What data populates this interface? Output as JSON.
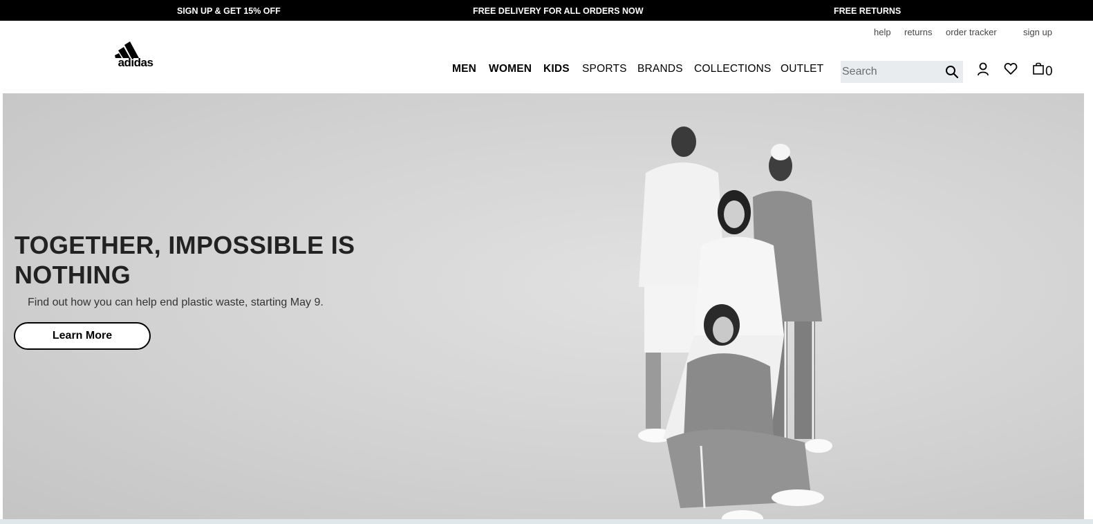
{
  "promo": {
    "left": "SIGN UP & GET 15% OFF",
    "center": "FREE DELIVERY FOR ALL ORDERS NOW",
    "right": "FREE RETURNS"
  },
  "utility_links": {
    "help": "help",
    "returns": "returns",
    "order_tracker": "order tracker",
    "sign_up": "sign up"
  },
  "brand": {
    "logo_text": "adidas"
  },
  "nav": {
    "men": "MEN",
    "women": "WOMEN",
    "kids": "KIDS",
    "sports": "SPORTS",
    "brands": "BRANDS",
    "collections": "COLLECTIONS",
    "outlet": "OUTLET"
  },
  "search": {
    "placeholder": "Search",
    "value": ""
  },
  "cart": {
    "count": "0"
  },
  "icons": [
    "search-icon",
    "user-icon",
    "heart-icon",
    "shopping-bag-icon"
  ],
  "hero": {
    "title": "TOGETHER, IMPOSSIBLE IS NOTHING",
    "subtitle": "Find out how you can help end plastic waste, starting May 9.",
    "cta_label": "Learn More"
  },
  "colors": {
    "promo_bg": "#000000",
    "search_bg": "#e9ecef",
    "hero_bg": "#d2d2d2",
    "text_dark": "#222222"
  }
}
